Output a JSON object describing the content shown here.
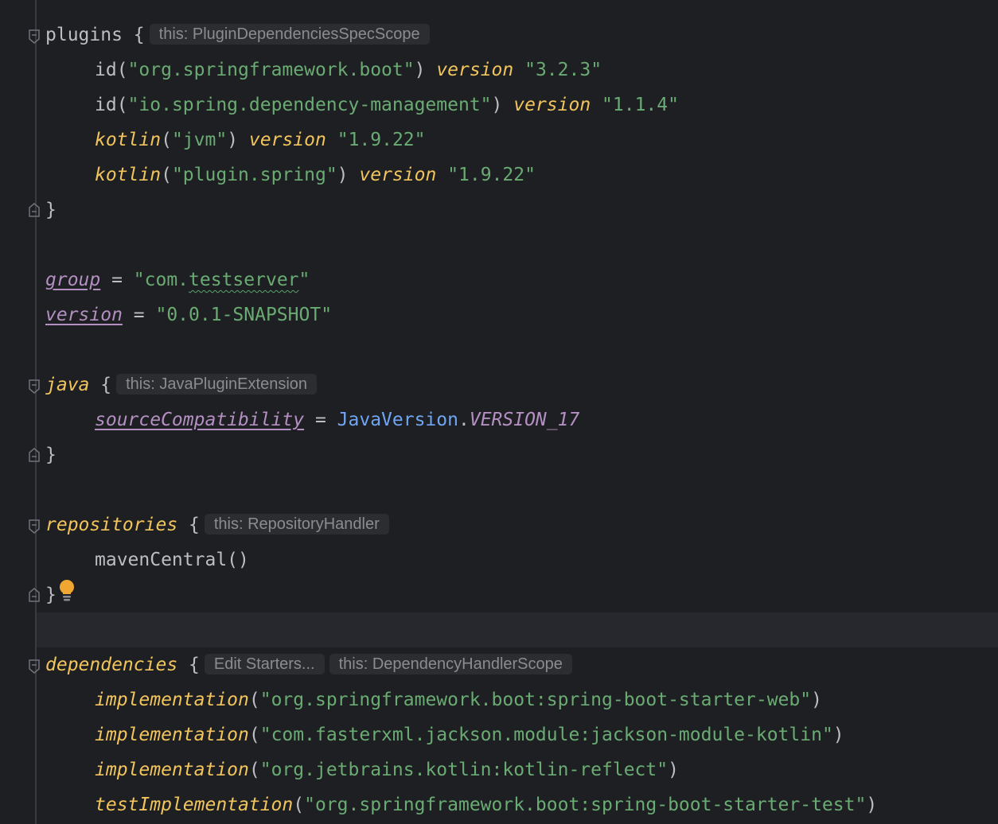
{
  "editor": {
    "language": "kotlin-gradle",
    "plugins": {
      "keyword": "plugins",
      "open_brace": " {",
      "hint": "this: PluginDependenciesSpecScope",
      "entries": [
        {
          "fn": "id",
          "open": "(",
          "arg": "\"org.springframework.boot\"",
          "close": ")",
          "infix": "version",
          "value": "\"3.2.3\""
        },
        {
          "fn": "id",
          "open": "(",
          "arg": "\"io.spring.dependency-management\"",
          "close": ")",
          "infix": "version",
          "value": "\"1.1.4\""
        },
        {
          "fn": "kotlin",
          "open": "(",
          "arg": "\"jvm\"",
          "close": ")",
          "infix": "version",
          "value": "\"1.9.22\""
        },
        {
          "fn": "kotlin",
          "open": "(",
          "arg": "\"plugin.spring\"",
          "close": ")",
          "infix": "version",
          "value": "\"1.9.22\""
        }
      ],
      "close_brace": "}"
    },
    "group": {
      "name": "group",
      "eq": " = ",
      "value_prefix": "\"com.",
      "value_typo": "testserver",
      "value_suffix": "\""
    },
    "version": {
      "name": "version",
      "eq": " = ",
      "value": "\"0.0.1-SNAPSHOT\""
    },
    "java": {
      "keyword": "java",
      "open_brace": " {",
      "hint": "this: JavaPluginExtension",
      "prop": "sourceCompatibility",
      "eq": " = ",
      "cls": "JavaVersion",
      "dot": ".",
      "const": "VERSION_17",
      "close_brace": "}"
    },
    "repositories": {
      "keyword": "repositories",
      "open_brace": " {",
      "hint": "this: RepositoryHandler",
      "entry": "mavenCentral()",
      "close_brace": "}"
    },
    "dependencies": {
      "keyword": "dependencies",
      "open_brace": " {",
      "action_hint": "Edit Starters...",
      "hint": "this: DependencyHandlerScope",
      "entries": [
        {
          "fn": "implementation",
          "open": "(",
          "arg": "\"org.springframework.boot:spring-boot-starter-web\"",
          "close": ")"
        },
        {
          "fn": "implementation",
          "open": "(",
          "arg": "\"com.fasterxml.jackson.module:jackson-module-kotlin\"",
          "close": ")"
        },
        {
          "fn": "implementation",
          "open": "(",
          "arg": "\"org.jetbrains.kotlin:kotlin-reflect\"",
          "close": ")"
        },
        {
          "fn": "testImplementation",
          "open": "(",
          "arg": "\"org.springframework.boot:spring-boot-starter-test\"",
          "close": ")"
        }
      ]
    },
    "icons": {
      "fold_open": "fold-open-icon",
      "fold_close": "fold-close-icon",
      "intention": "lightbulb-icon"
    },
    "colors": {
      "background": "#1e1f22",
      "keyword": "#f2c55c",
      "string": "#6aab73",
      "property": "#b48fc1",
      "class": "#6fa5f2",
      "text": "#bcbec4",
      "hint_bg": "#2b2d30",
      "hint_text": "#8a8c91",
      "bulb": "#f0a732"
    }
  }
}
